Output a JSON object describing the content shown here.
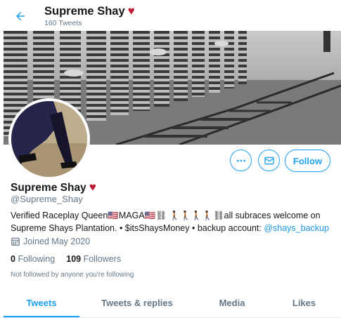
{
  "header": {
    "name": "Supreme Shay",
    "heart": "♥",
    "tweet_count": "160 Tweets"
  },
  "profile": {
    "name": "Supreme Shay",
    "heart": "♥",
    "handle": "@Supreme_Shay",
    "bio_text": "Verified Raceplay Queen🇺🇸MAGA🇺🇸⛓ 🚶🏿🚶🏿🚶🏿🚶🏿⛓all subraces welcome on Supreme Shays Plantation. • $itsShaysMoney • backup account: ",
    "bio_link": "@shays_backup",
    "joined": "Joined May 2020",
    "following_count": "0",
    "following_label": "Following",
    "followers_count": "109",
    "followers_label": "Followers",
    "not_followed": "Not followed by anyone you're following"
  },
  "actions": {
    "follow_label": "Follow",
    "more_icon": "more-dots-icon",
    "message_icon": "envelope-icon"
  },
  "tabs": [
    {
      "label": "Tweets",
      "active": true
    },
    {
      "label": "Tweets & replies",
      "active": false
    },
    {
      "label": "Media",
      "active": false
    },
    {
      "label": "Likes",
      "active": false
    }
  ],
  "colors": {
    "accent": "#1da1f2",
    "heart": "#be1931",
    "secondary_text": "#657786"
  }
}
